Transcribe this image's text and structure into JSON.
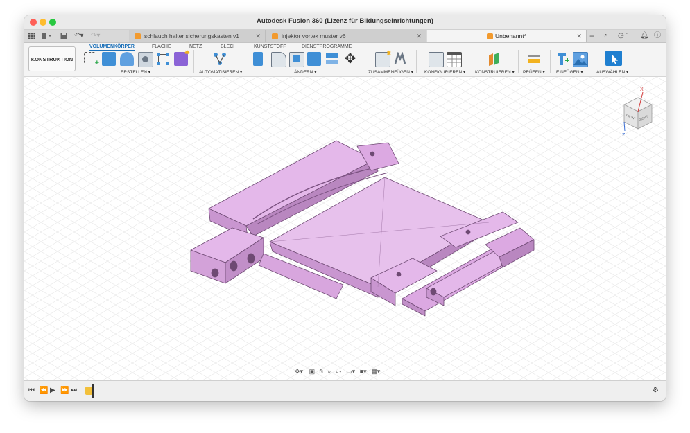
{
  "window": {
    "title": "Autodesk Fusion 360 (Lizenz für Bildungseinrichtungen)"
  },
  "tabs": [
    {
      "label": "schlauch halter sicherungskasten v1",
      "active": false
    },
    {
      "label": "injektor vortex muster v6",
      "active": false
    },
    {
      "label": "Unbenannt*",
      "active": true
    }
  ],
  "tabbar": {
    "user_count": "1"
  },
  "toolbar": {
    "workspace": "KONSTRUKTION",
    "ribbon_tabs": [
      "VOLUMENKÖRPER",
      "FLÄCHE",
      "NETZ",
      "BLECH",
      "KUNSTSTOFF",
      "DIENSTPROGRAMME"
    ],
    "groups": [
      "ERSTELLEN",
      "AUTOMATISIEREN",
      "ÄNDERN",
      "ZUSAMMENFÜGEN",
      "KONFIGURIEREN",
      "KONSTRUIEREN",
      "PRÜFEN",
      "EINFÜGEN",
      "AUSWÄHLEN"
    ]
  },
  "viewcube": {
    "x": "X",
    "z": "Z",
    "front": "FRONT",
    "right": "RIGHT"
  },
  "colors": {
    "accent": "#1a6fb8",
    "body": "#e4b8ea",
    "edge": "#6e4a73",
    "tab_icon": "#f29a2e"
  }
}
